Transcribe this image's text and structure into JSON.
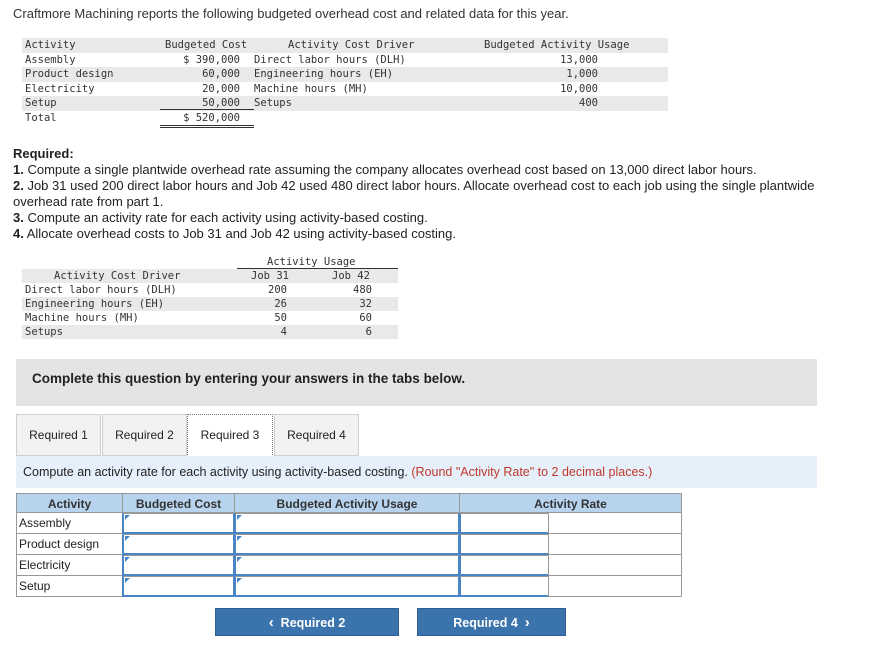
{
  "intro": "Craftmore Machining reports the following budgeted overhead cost and related data for this year.",
  "table1": {
    "headers": {
      "activity": "Activity",
      "cost": "Budgeted Cost",
      "driver": "Activity Cost Driver",
      "usage": "Budgeted Activity Usage"
    },
    "rows": [
      {
        "activity": "Assembly",
        "cost": "$ 390,000",
        "driver": "Direct labor hours (DLH)",
        "usage": "13,000"
      },
      {
        "activity": "Product design",
        "cost": "60,000",
        "driver": "Engineering hours (EH)",
        "usage": "1,000"
      },
      {
        "activity": "Electricity",
        "cost": "20,000",
        "driver": "Machine hours (MH)",
        "usage": "10,000"
      },
      {
        "activity": "Setup",
        "cost": "50,000",
        "driver": "Setups",
        "usage": "400"
      },
      {
        "activity": "Total",
        "cost": "$ 520,000",
        "driver": "",
        "usage": ""
      }
    ]
  },
  "required": {
    "heading": "Required:",
    "items": [
      {
        "num": "1.",
        "text": " Compute a single plantwide overhead rate assuming the company allocates overhead cost based on 13,000 direct labor hours."
      },
      {
        "num": "2.",
        "text": " Job 31 used 200 direct labor hours and Job 42 used 480 direct labor hours. Allocate overhead cost to each job using the single plantwide overhead rate from part 1."
      },
      {
        "num": "3.",
        "text": " Compute an activity rate for each activity using activity-based costing."
      },
      {
        "num": "4.",
        "text": " Allocate overhead costs to Job 31 and Job 42 using activity-based costing."
      }
    ]
  },
  "table2": {
    "group_header": "Activity Usage",
    "driver_header": "Activity Cost Driver",
    "job31_header": "Job 31",
    "job42_header": "Job 42",
    "rows": [
      {
        "driver": "Direct labor hours (DLH)",
        "job31": "200",
        "job42": "480"
      },
      {
        "driver": "Engineering hours (EH)",
        "job31": "26",
        "job42": "32"
      },
      {
        "driver": "Machine hours (MH)",
        "job31": "50",
        "job42": "60"
      },
      {
        "driver": "Setups",
        "job31": "4",
        "job42": "6"
      }
    ]
  },
  "banner": "Complete this question by entering your answers in the tabs below.",
  "tabs": [
    {
      "label": "Required 1",
      "active": false
    },
    {
      "label": "Required 2",
      "active": false
    },
    {
      "label": "Required 3",
      "active": true
    },
    {
      "label": "Required 4",
      "active": false
    }
  ],
  "instruction": {
    "text": "Compute an activity rate for each activity using activity-based costing. ",
    "note": "(Round \"Activity Rate\" to 2 decimal places.)"
  },
  "answer_table": {
    "headers": {
      "activity": "Activity",
      "cost": "Budgeted Cost",
      "usage": "Budgeted Activity Usage",
      "rate": "Activity Rate"
    },
    "rows": [
      "Assembly",
      "Product design",
      "Electricity",
      "Setup"
    ]
  },
  "nav": {
    "prev_label": "Required 2",
    "next_label": "Required 4",
    "prev_icon": "chevron-left-icon",
    "next_icon": "chevron-right-icon"
  },
  "colors": {
    "accent": "#3b73ad",
    "header_blue": "#b7d3ee",
    "note_red": "#c0392b",
    "input_border": "#4a86c5"
  }
}
